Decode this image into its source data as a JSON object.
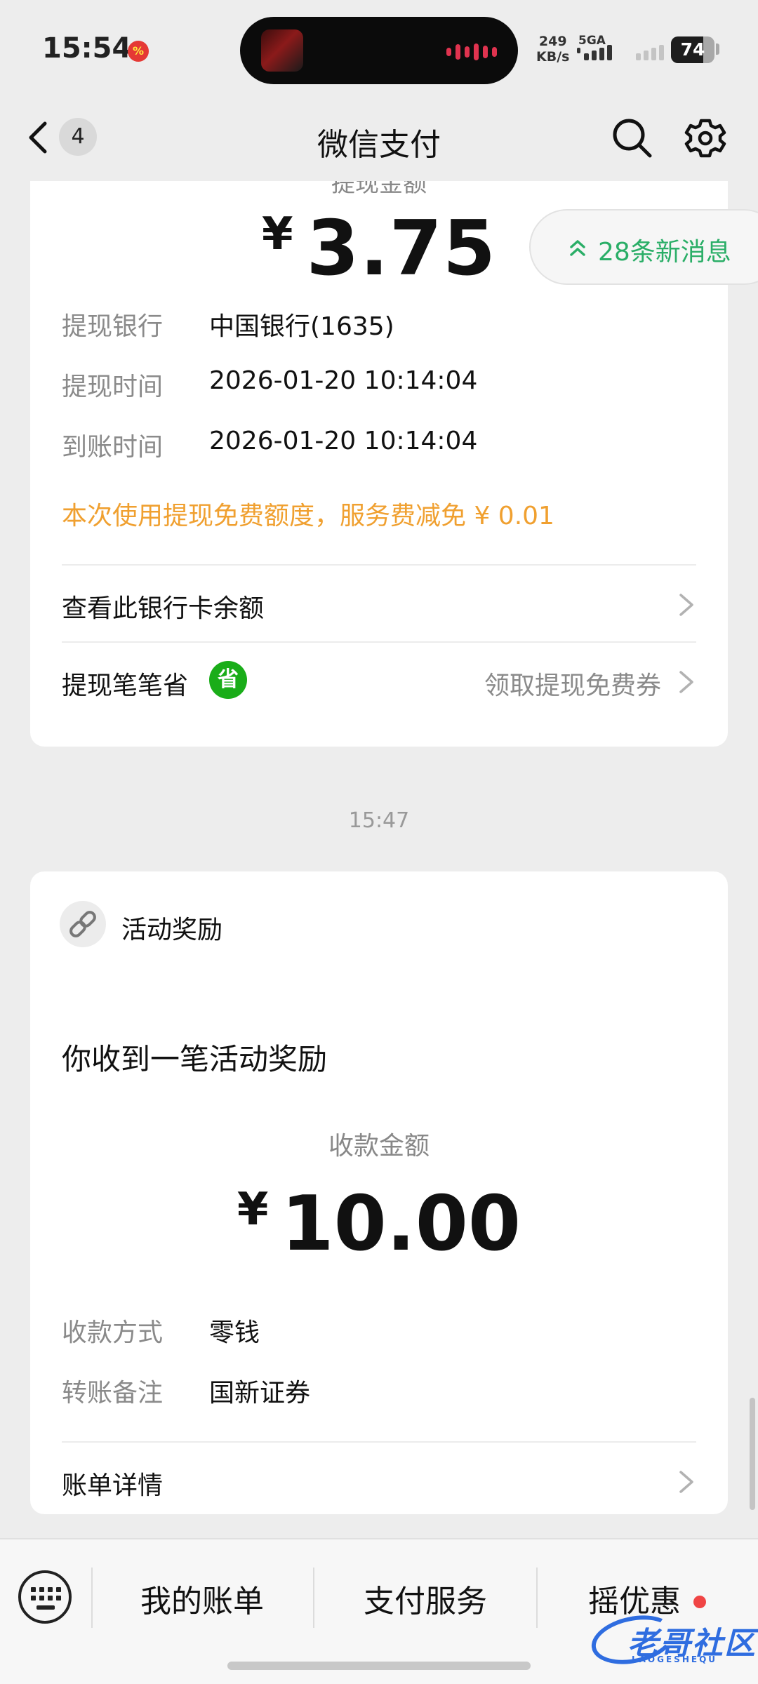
{
  "status_bar": {
    "time": "15:54",
    "notification_badge": "%",
    "net_speed_value": "249",
    "net_speed_unit": "KB/s",
    "network_type": "5GA",
    "battery": "74",
    "battery_level": 0.74
  },
  "nav": {
    "back_count": "4",
    "title": "微信支付"
  },
  "new_messages": "28条新消息",
  "withdraw_card": {
    "partial_label": "提现金额",
    "currency": "¥",
    "amount": "3.75",
    "rows": [
      {
        "label": "提现银行",
        "value": "中国银行(1635)"
      },
      {
        "label": "提现时间",
        "value": "2026-01-20 10:14:04"
      },
      {
        "label": "到账时间",
        "value": "2026-01-20 10:14:04"
      }
    ],
    "note": "本次使用提现免费额度，服务费减免 ¥ 0.01",
    "balance_link": "查看此银行卡余额",
    "save_label": "提现笔笔省",
    "save_icon_text": "省",
    "save_action": "领取提现免费券"
  },
  "timestamp": "15:47",
  "reward_card": {
    "header": "活动奖励",
    "title": "你收到一笔活动奖励",
    "amount_label": "收款金额",
    "currency": "¥",
    "amount": "10.00",
    "rows": [
      {
        "label": "收款方式",
        "value": "零钱"
      },
      {
        "label": "转账备注",
        "value": "国新证券"
      }
    ],
    "details_link": "账单详情"
  },
  "bottom_menu": {
    "items": [
      "我的账单",
      "支付服务",
      "摇优惠"
    ]
  },
  "watermark": {
    "text": "老哥社区",
    "sub": "LAOGESHEQU"
  },
  "colors": {
    "accent_green": "#2aae67",
    "note_orange": "#f0a030",
    "wechat_green": "#1aad19"
  }
}
